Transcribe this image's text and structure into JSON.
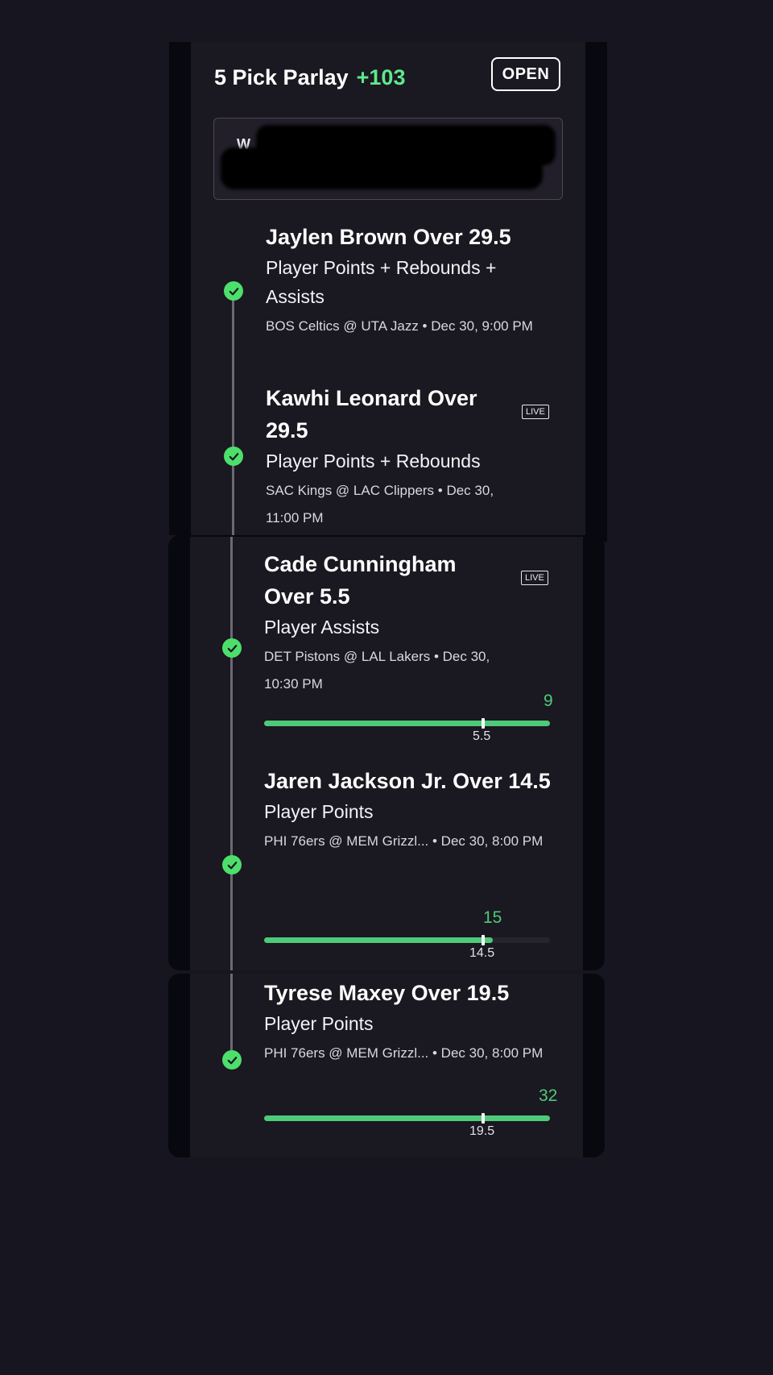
{
  "header": {
    "title": "5 Pick Parlay",
    "odds": "+103",
    "status_button": "OPEN"
  },
  "note": {
    "visible_text": "W"
  },
  "picks": [
    {
      "title": "Jaylen Brown Over 29.5",
      "market": "Player Points + Rebounds + Assists",
      "game": "BOS Celtics @ UTA Jazz • Dec 30, 9:00 PM",
      "status": "won"
    },
    {
      "title": "Kawhi Leonard Over 29.5",
      "market": "Player Points + Rebounds",
      "game": "SAC Kings @ LAC Clippers • Dec 30, 11:00 PM",
      "badge": "LIVE",
      "status": "won"
    },
    {
      "title": "Cade Cunningham Over 5.5",
      "market": "Player Assists",
      "game": "DET Pistons @ LAL Lakers • Dec 30, 10:30 PM",
      "badge": "LIVE",
      "current": "9",
      "line": "5.5",
      "progress": 1.0,
      "status": "won"
    },
    {
      "title": "Jaren Jackson Jr. Over 14.5",
      "market": "Player Points",
      "game": "PHI 76ers @ MEM Grizzl... • Dec 30, 8:00 PM",
      "current": "15",
      "line": "14.5",
      "progress": 0.8,
      "status": "won"
    },
    {
      "title": "Tyrese Maxey Over 19.5",
      "market": "Player Points",
      "game": "PHI 76ers @ MEM Grizzl... • Dec 30, 8:00 PM",
      "current": "32",
      "line": "19.5",
      "progress": 1.0,
      "status": "won"
    }
  ],
  "colors": {
    "accent_green": "#5ee88c",
    "check_green": "#4cdf6c",
    "bar_green": "#4fc97a",
    "background": "#17151f",
    "card": "#1a1820"
  }
}
